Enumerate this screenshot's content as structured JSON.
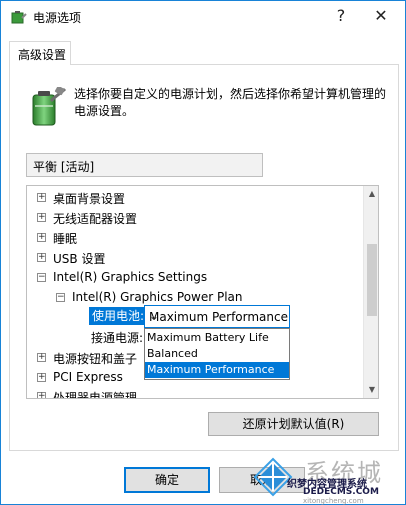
{
  "window": {
    "title": "电源选项",
    "help_icon": "?",
    "close_icon": "✕"
  },
  "tab": {
    "label": "高级设置"
  },
  "description": "选择你要自定义的电源计划，然后选择你希望计算机管理的电源设置。",
  "plan_select": {
    "value": "平衡 [活动]"
  },
  "tree": {
    "items": [
      {
        "label": "桌面背景设置",
        "expander": "+"
      },
      {
        "label": "无线适配器设置",
        "expander": "+"
      },
      {
        "label": "睡眠",
        "expander": "+"
      },
      {
        "label": "USB 设置",
        "expander": "+"
      },
      {
        "label": "Intel(R) Graphics Settings",
        "expander": "−"
      },
      {
        "label": "Intel(R) Graphics Power Plan",
        "expander": "−"
      },
      {
        "label": "电源按钮和盖子",
        "expander": "+"
      },
      {
        "label": "PCI Express",
        "expander": "+"
      },
      {
        "label": "处理器电源管理",
        "expander": "+"
      }
    ],
    "setting_battery_label": "使用电池:",
    "setting_plugged_label": "接通电源:"
  },
  "combo": {
    "value": "Maximum Performance",
    "options": [
      "Maximum Battery Life",
      "Balanced",
      "Maximum Performance"
    ],
    "selected_index": 2
  },
  "buttons": {
    "restore": "还原计划默认值(R)",
    "ok": "确定",
    "cancel": "取消"
  },
  "watermark": {
    "big": "系统城",
    "mid": "织梦内容管理系统",
    "url": "DEDECMS.COM",
    "small": "xitongcheng.com"
  },
  "colors": {
    "accent": "#0078d7",
    "window_border": "#1883d7"
  }
}
